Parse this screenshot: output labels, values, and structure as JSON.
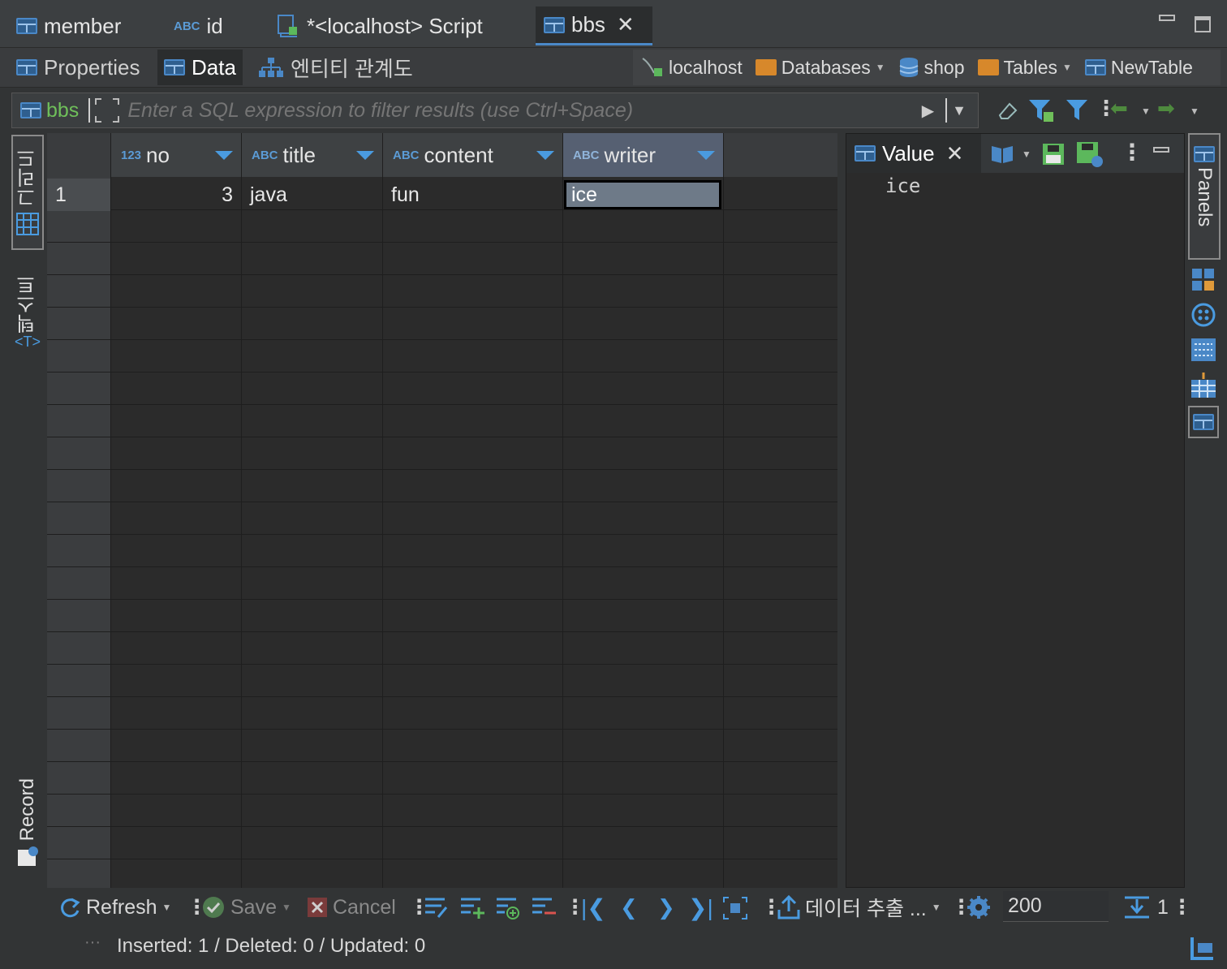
{
  "editor_tabs": [
    {
      "label": "member",
      "icon": "table-icon"
    },
    {
      "label": "id",
      "icon": "abc-type-icon",
      "type_badge": "ABC"
    },
    {
      "label": "*<localhost> Script",
      "icon": "script-icon"
    },
    {
      "label": "bbs",
      "icon": "table-icon",
      "active": true
    }
  ],
  "sub_tabs": [
    {
      "label": "Properties"
    },
    {
      "label": "Data",
      "active": true
    },
    {
      "label": "엔티티 관계도"
    }
  ],
  "breadcrumb": {
    "connection": "localhost",
    "databases": "Databases",
    "database": "shop",
    "tables": "Tables",
    "new_table": "NewTable"
  },
  "filter": {
    "table": "bbs",
    "placeholder": "Enter a SQL expression to filter results (use Ctrl+Space)"
  },
  "left_tabs": {
    "grid": "그리드",
    "text": "텍스트",
    "record": "Record"
  },
  "grid": {
    "columns": [
      {
        "name": "no",
        "type": "123"
      },
      {
        "name": "title",
        "type": "ABC"
      },
      {
        "name": "content",
        "type": "ABC"
      },
      {
        "name": "writer",
        "type": "ABC",
        "selected": true
      }
    ],
    "rows": [
      {
        "num": "1",
        "no": "3",
        "title": "java",
        "content": "fun",
        "writer": "ice"
      }
    ]
  },
  "value_panel": {
    "title": "Value",
    "value": "ice"
  },
  "right_tabs": {
    "panels": "Panels"
  },
  "bottom": {
    "refresh": "Refresh",
    "save": "Save",
    "cancel": "Cancel",
    "export": "데이터 추출 ...",
    "fetch_size": "200",
    "row_count": "1"
  },
  "status": "Inserted: 1 / Deleted: 0 / Updated: 0",
  "colors": {
    "accent": "#4a88c7",
    "selected_header": "#566072",
    "background": "#2b2b2b"
  }
}
